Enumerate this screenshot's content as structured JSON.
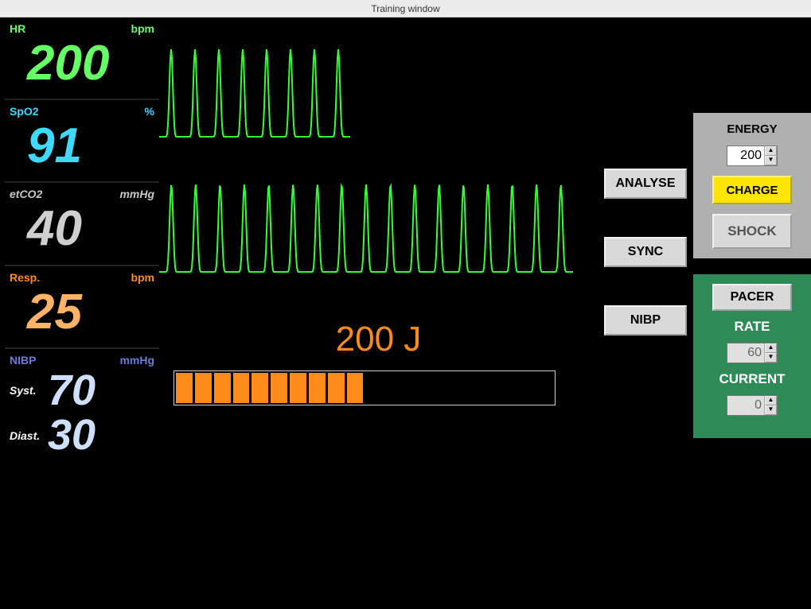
{
  "window": {
    "title": "Training window"
  },
  "vitals": {
    "hr": {
      "label": "HR",
      "unit": "bpm",
      "value": "200"
    },
    "spo2": {
      "label": "SpO2",
      "unit": "%",
      "value": "91"
    },
    "etco2": {
      "label": "etCO2",
      "unit": "mmHg",
      "value": "40"
    },
    "resp": {
      "label": "Resp.",
      "unit": "bpm",
      "value": "25"
    },
    "nibp": {
      "label": "NIBP",
      "unit": "mmHg",
      "syst_label": "Syst.",
      "syst": "70",
      "diast_label": "Diast.",
      "diast": "30"
    }
  },
  "buttons": {
    "analyse": "ANALYSE",
    "sync": "SYNC",
    "nibp": "NIBP"
  },
  "defib": {
    "energy_label": "ENERGY",
    "energy_value": "200",
    "charge": "CHARGE",
    "shock": "SHOCK",
    "charge_display": "200 J",
    "progress_filled": 10,
    "progress_total": 20
  },
  "pacer": {
    "button": "PACER",
    "rate_label": "RATE",
    "rate_value": "60",
    "current_label": "CURRENT",
    "current_value": "0"
  },
  "colors": {
    "hr": "#66ff66",
    "spo2": "#3fd8ff",
    "etco2": "#cfcfcf",
    "resp": "#ffb366",
    "nibp": "#cfe0ff",
    "charge_btn": "#ffe500",
    "pacer_bg": "#2e8b57",
    "wave": "#33ff33",
    "progress": "#ff8c1a"
  }
}
